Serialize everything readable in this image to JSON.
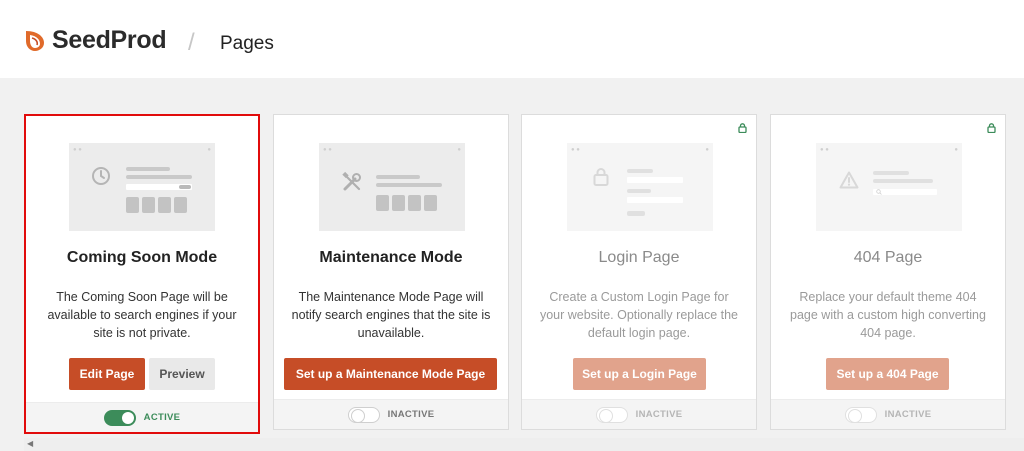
{
  "header": {
    "brand": "SeedProd",
    "separator": "/",
    "page_title": "Pages"
  },
  "colors": {
    "accent": "#c64d27",
    "accent_faded": "#e1a38c",
    "active_green": "#3c8c5a",
    "selection_outline": "#e10b0b"
  },
  "cards": [
    {
      "title": "Coming Soon Mode",
      "description": "The Coming Soon Page will be available to search engines if your site is not private.",
      "primary_button": "Edit Page",
      "secondary_button": "Preview",
      "status": "ACTIVE",
      "toggle_on": true,
      "locked": false,
      "icon": "clock-icon"
    },
    {
      "title": "Maintenance Mode",
      "description": "The Maintenance Mode Page will notify search engines that the site is unavailable.",
      "primary_button": "Set up a Maintenance Mode Page",
      "status": "INACTIVE",
      "toggle_on": false,
      "locked": false,
      "icon": "tools-icon"
    },
    {
      "title": "Login Page",
      "description": "Create a Custom Login Page for your website. Optionally replace the default login page.",
      "primary_button": "Set up a Login Page",
      "status": "INACTIVE",
      "toggle_on": false,
      "locked": true,
      "icon": "padlock-icon"
    },
    {
      "title": "404 Page",
      "description": "Replace your default theme 404 page with a custom high converting 404 page.",
      "primary_button": "Set up a 404 Page",
      "status": "INACTIVE",
      "toggle_on": false,
      "locked": true,
      "icon": "warning-icon"
    }
  ]
}
